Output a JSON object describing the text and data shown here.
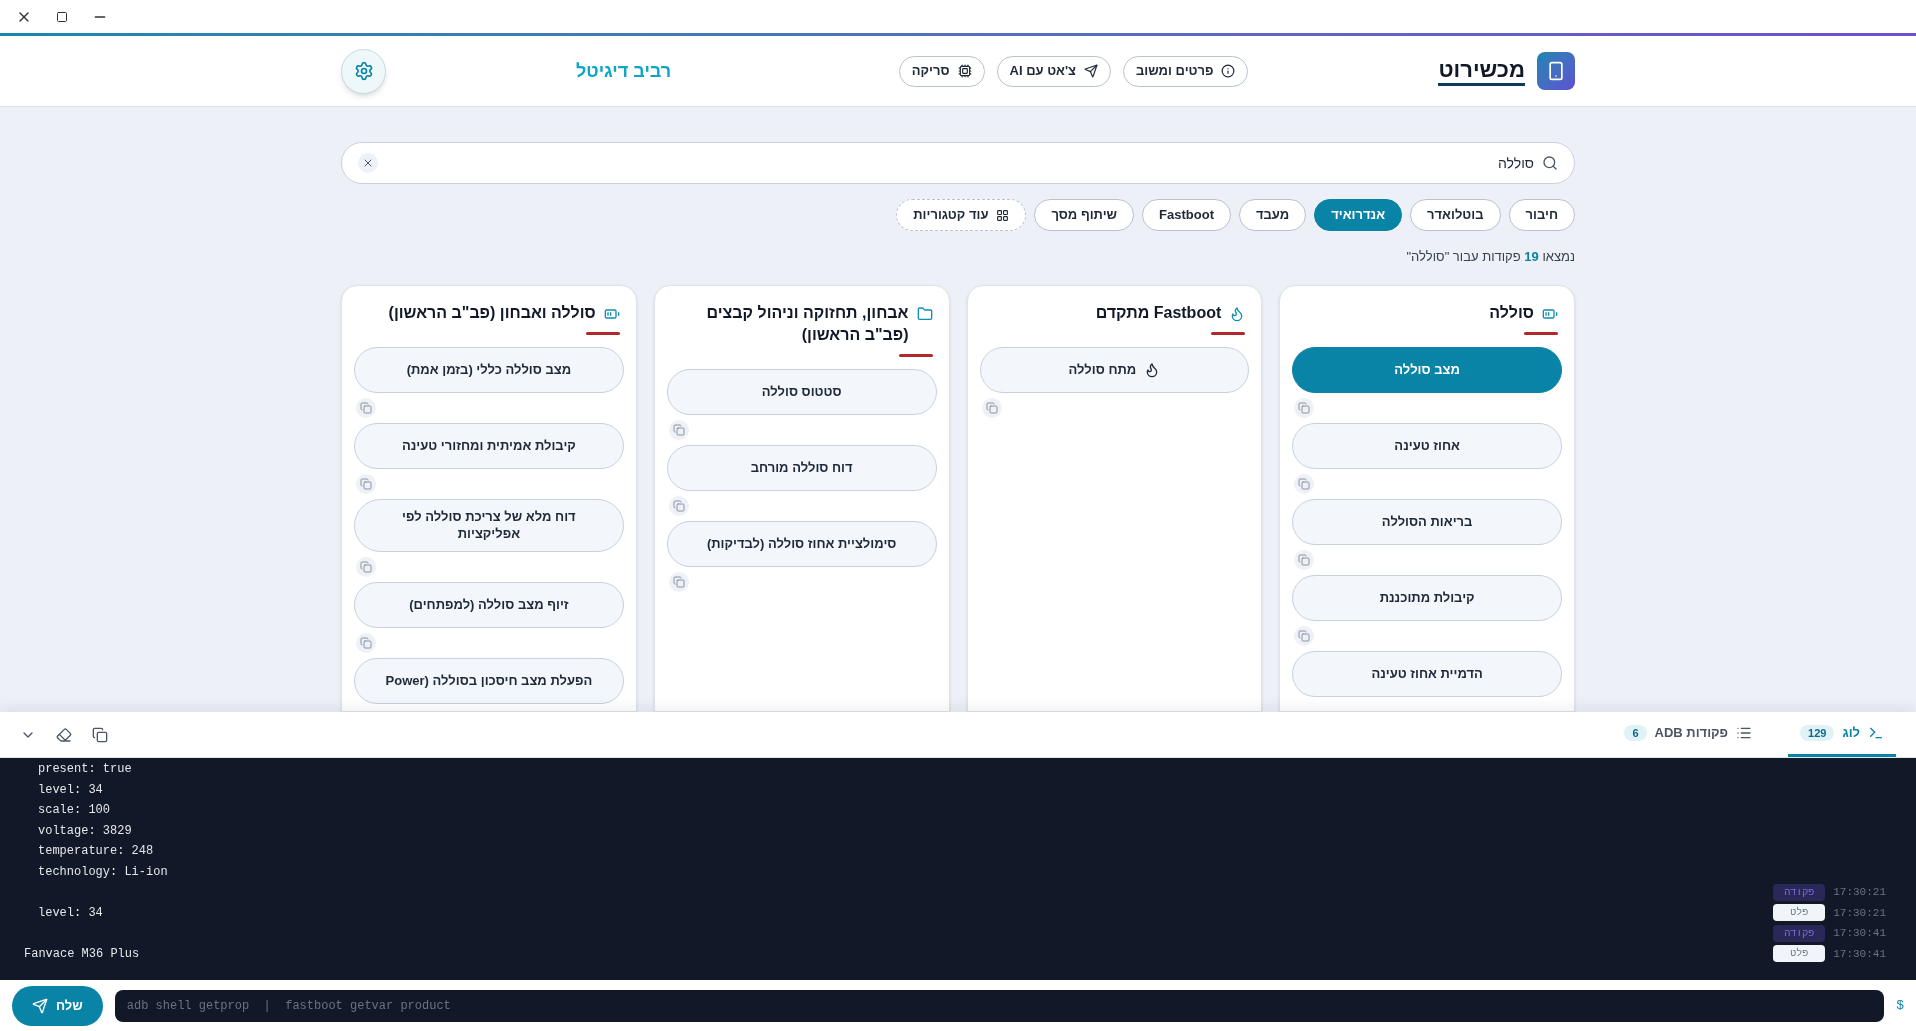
{
  "header": {
    "app_name": "מכשירוט",
    "buttons": [
      {
        "label": "פרטים ומשוב",
        "kind": "info"
      },
      {
        "label": "צ'אט עם AI",
        "kind": "send"
      },
      {
        "label": "סריקה",
        "kind": "chip"
      }
    ],
    "brand": "רביב דיגיטל"
  },
  "search": {
    "value": "סוללה"
  },
  "categories": [
    {
      "label": "חיבור",
      "selected": false
    },
    {
      "label": "בוטלואדר",
      "selected": false
    },
    {
      "label": "אנדרואיד",
      "selected": true
    },
    {
      "label": "מעבד",
      "selected": false
    },
    {
      "label": "Fastboot",
      "selected": false
    },
    {
      "label": "שיתוף מסך",
      "selected": false
    }
  ],
  "more_categories": "עוד קטגוריות",
  "results_text": "נמצאו **19** פקודות עבור \"סוללה\"",
  "cards": [
    {
      "title": "סוללה",
      "kind": "battery",
      "items": [
        {
          "label": "מצב סוללה",
          "selected": true
        },
        {
          "label": "אחוז טעינה",
          "selected": false
        },
        {
          "label": "בריאות הסוללה",
          "selected": false
        },
        {
          "label": "קיבולת מתוכננת",
          "selected": false
        },
        {
          "label": "הדמיית אחוז טעינה",
          "selected": false
        }
      ]
    },
    {
      "title": "Fastboot מתקדם",
      "kind": "flame",
      "items": [
        {
          "label": "מתח סוללה",
          "selected": false,
          "kind": "flame"
        }
      ]
    },
    {
      "title": "אבחון, תחזוקה וניהול קבצים (פב\"ב הראשון)",
      "kind": "folder",
      "items": [
        {
          "label": "סטטוס סוללה",
          "selected": false
        },
        {
          "label": "דוח סוללה מורחב",
          "selected": false
        },
        {
          "label": "סימולציית אחוז סוללה (לבדיקות)",
          "selected": false
        }
      ]
    },
    {
      "title": "סוללה ואבחון (פב\"ב הראשון)",
      "kind": "battery",
      "items": [
        {
          "label": "מצב סוללה כללי (בזמן אמת)",
          "selected": false
        },
        {
          "label": "קיבולת אמיתית ומחזורי טעינה",
          "selected": false
        },
        {
          "label": "דוח מלא של צריכת סוללה לפי אפליקציות",
          "selected": false
        },
        {
          "label": "זיוף מצב סוללה (למפתחים)",
          "selected": false
        },
        {
          "label": "הפעלת מצב חיסכון בסוללה (Power",
          "selected": false
        }
      ]
    }
  ],
  "console": {
    "tabs": [
      {
        "label": "לוג",
        "count": "129",
        "kind": "terminal",
        "selected": true
      },
      {
        "label": "פקודות ADB",
        "count": "6",
        "kind": "list",
        "selected": false
      }
    ],
    "log": [
      {
        "text": "present: true"
      },
      {
        "text": "level: 34"
      },
      {
        "text": "scale: 100"
      },
      {
        "text": "voltage: 3829"
      },
      {
        "text": "temperature: 248"
      },
      {
        "text": "technology: Li-ion"
      },
      {
        "kind": "command",
        "tag": "פקודה",
        "time": "17:30:21"
      },
      {
        "kind": "output",
        "text": "level: 34",
        "tag": "פלט",
        "time": "17:30:21"
      },
      {
        "kind": "command",
        "tag": "פקודה",
        "time": "17:30:41"
      },
      {
        "kind": "output",
        "text": "Fanvace M36 Plus",
        "tag": "פלט",
        "time": "17:30:41"
      }
    ],
    "input": {
      "placeholder": "adb shell getprop  |  fastboot getvar product",
      "prompt": "$"
    },
    "send": "שלח"
  }
}
